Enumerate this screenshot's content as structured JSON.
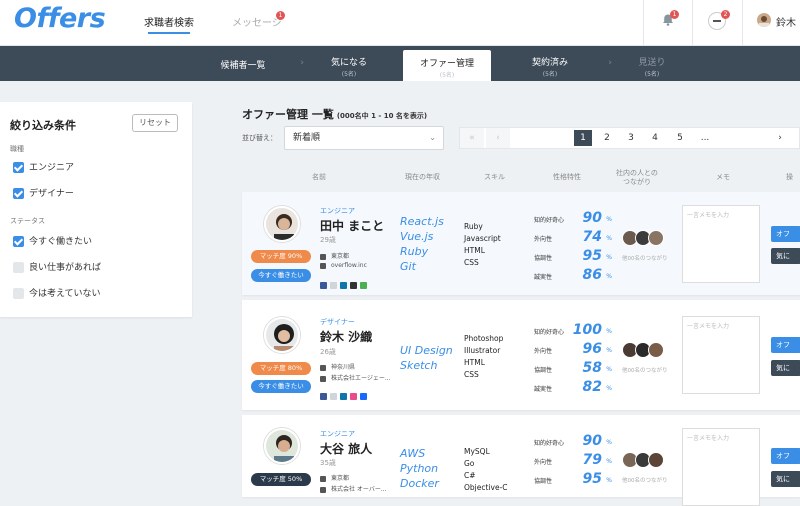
{
  "app": {
    "logo": "Offers"
  },
  "topnav": {
    "search": "求職者検索",
    "messages": "メッセージ",
    "messages_badge": "1",
    "bell_badge": "1",
    "company_badge": "2",
    "user_name": "鈴木"
  },
  "tabs": [
    {
      "label": "候補者一覧",
      "count": ""
    },
    {
      "label": "気になる",
      "count": "(5名)"
    },
    {
      "label": "オファー管理",
      "count": "(5名)"
    },
    {
      "label": "契約済み",
      "count": "(5名)"
    },
    {
      "label": "見送り",
      "count": "(5名)"
    }
  ],
  "filters": {
    "title": "絞り込み条件",
    "reset": "リセット",
    "job_heading": "職種",
    "jobs": [
      {
        "label": "エンジニア",
        "checked": true
      },
      {
        "label": "デザイナー",
        "checked": true
      }
    ],
    "status_heading": "ステータス",
    "statuses": [
      {
        "label": "今すぐ働きたい",
        "checked": true
      },
      {
        "label": "良い仕事があれば",
        "checked": false
      },
      {
        "label": "今は考えていない",
        "checked": false
      }
    ]
  },
  "main": {
    "title": "オファー管理 一覧",
    "subtitle": "(000名中 1 - 10 名を表示)"
  },
  "sort": {
    "label": "並び替え：",
    "value": "新着順"
  },
  "pagination": {
    "pages": [
      "1",
      "2",
      "3",
      "4",
      "5",
      "..."
    ],
    "current": "1"
  },
  "columns": {
    "name": "名前",
    "annual": "現在の年収",
    "skill": "スキル",
    "trait": "性格特性",
    "friends": "社内の人との\nつながり",
    "memo": "メモ",
    "action": "操"
  },
  "candidates": [
    {
      "job": "エンジニア",
      "name": "田中 まこと",
      "age": "29歳",
      "location": "東京都",
      "company": "overflow.inc",
      "match": "マッチ度 90%",
      "match_color": "#ef8a4a",
      "availability": "今すぐ働きたい",
      "skills_main": [
        "React.js",
        "Vue.js",
        "Ruby",
        "Git"
      ],
      "skills_sub": [
        "Ruby",
        "Javascript",
        "HTML",
        "CSS"
      ],
      "traits": [
        {
          "label": "知的好奇心",
          "value": "90"
        },
        {
          "label": "外向性",
          "value": "74"
        },
        {
          "label": "協調性",
          "value": "95"
        },
        {
          "label": "誠実性",
          "value": "86"
        }
      ],
      "friends_note": "他00名のつながり",
      "memo_placeholder": "一言メモを入力",
      "offer": "オフ",
      "note": "気に"
    },
    {
      "job": "デザイナー",
      "name": "鈴木 沙織",
      "age": "26歳",
      "location": "神奈川県",
      "company": "株式会社エージェー...",
      "match": "マッチ度 80%",
      "match_color": "#ef8a4a",
      "availability": "今すぐ働きたい",
      "skills_main": [
        "UI Design",
        "Sketch"
      ],
      "skills_sub": [
        "Photoshop",
        "Illustrator",
        "HTML",
        "CSS"
      ],
      "traits": [
        {
          "label": "知的好奇心",
          "value": "100"
        },
        {
          "label": "外向性",
          "value": "96"
        },
        {
          "label": "協調性",
          "value": "58"
        },
        {
          "label": "誠実性",
          "value": "82"
        }
      ],
      "friends_note": "他00名のつながり",
      "memo_placeholder": "一言メモを入力",
      "offer": "オフ",
      "note": "気に"
    },
    {
      "job": "エンジニア",
      "name": "大谷 旅人",
      "age": "35歳",
      "location": "東京都",
      "company": "株式会社 オーバー...",
      "match": "マッチ度 50%",
      "match_color": "#2b3a4a",
      "skills_main": [
        "AWS",
        "Python",
        "Docker"
      ],
      "skills_sub": [
        "MySQL",
        "Go",
        "C#",
        "Objective-C"
      ],
      "traits": [
        {
          "label": "知的好奇心",
          "value": "90"
        },
        {
          "label": "外向性",
          "value": "79"
        },
        {
          "label": "協調性",
          "value": "95"
        }
      ],
      "friends_note": "他00名のつながり",
      "memo_placeholder": "一言メモを入力",
      "offer": "オフ",
      "note": "気に"
    }
  ],
  "colors": {
    "accent": "#3a8ee6",
    "navbar": "#3d4a57",
    "match_orange": "#ef8a4a"
  }
}
